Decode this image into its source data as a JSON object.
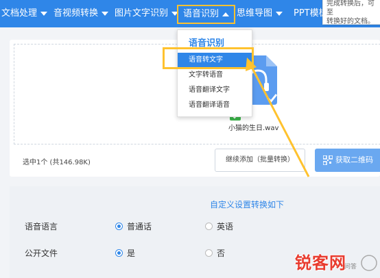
{
  "nav": {
    "items": [
      {
        "label": "文档处理"
      },
      {
        "label": "音视频转换"
      },
      {
        "label": "图片文字识别"
      },
      {
        "label": "语音识别"
      },
      {
        "label": "思维导图"
      },
      {
        "label": "PPT模板"
      }
    ]
  },
  "tooltip": {
    "line1": "完成转换后，可至",
    "line2": "转换好的文档。"
  },
  "dropdown": {
    "title": "语音识别",
    "items": [
      "语音转文字",
      "文字转语音",
      "语音翻译文字",
      "语音翻译语音"
    ]
  },
  "upload": {
    "file_name": "小猫的生日.wav",
    "selected_info": "选中1个 (共146.98K)",
    "add_button": "继续添加（批量转换）",
    "qr_button": "获取二维码"
  },
  "settings": {
    "title": "自定义设置转换如下",
    "rows": [
      {
        "label": "语音语言",
        "options": [
          "普通话",
          "英语"
        ],
        "selected": 0
      },
      {
        "label": "公开文件",
        "options": [
          "是",
          "否"
        ],
        "selected": 0
      }
    ]
  },
  "watermark": {
    "text": "锐客网",
    "sub": "问答"
  },
  "colors": {
    "nav_bg": "#2f86e8",
    "highlight": "#ffc22e",
    "accent": "#2f86e8"
  }
}
